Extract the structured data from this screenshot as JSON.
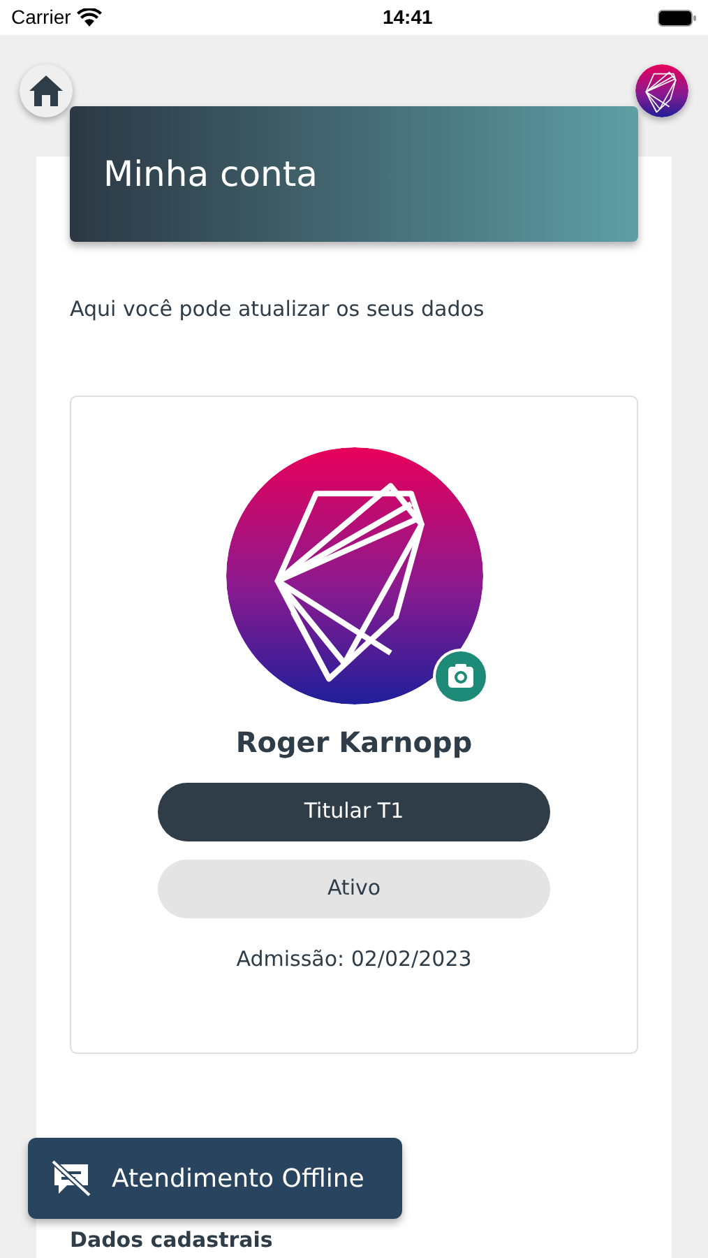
{
  "status_bar": {
    "carrier": "Carrier",
    "time": "14:41"
  },
  "header": {
    "title": "Minha conta"
  },
  "intro": "Aqui você pode atualizar os seus dados",
  "profile": {
    "name": "Roger Karnopp",
    "badges": [
      {
        "label": "Titular T1",
        "kind": "primary"
      },
      {
        "label": "Ativo",
        "kind": "secondary"
      }
    ],
    "admission": "Admissão: 02/02/2023"
  },
  "section_title": "Dados cadastrais",
  "chat_button": {
    "label": "Atendimento Offline"
  }
}
